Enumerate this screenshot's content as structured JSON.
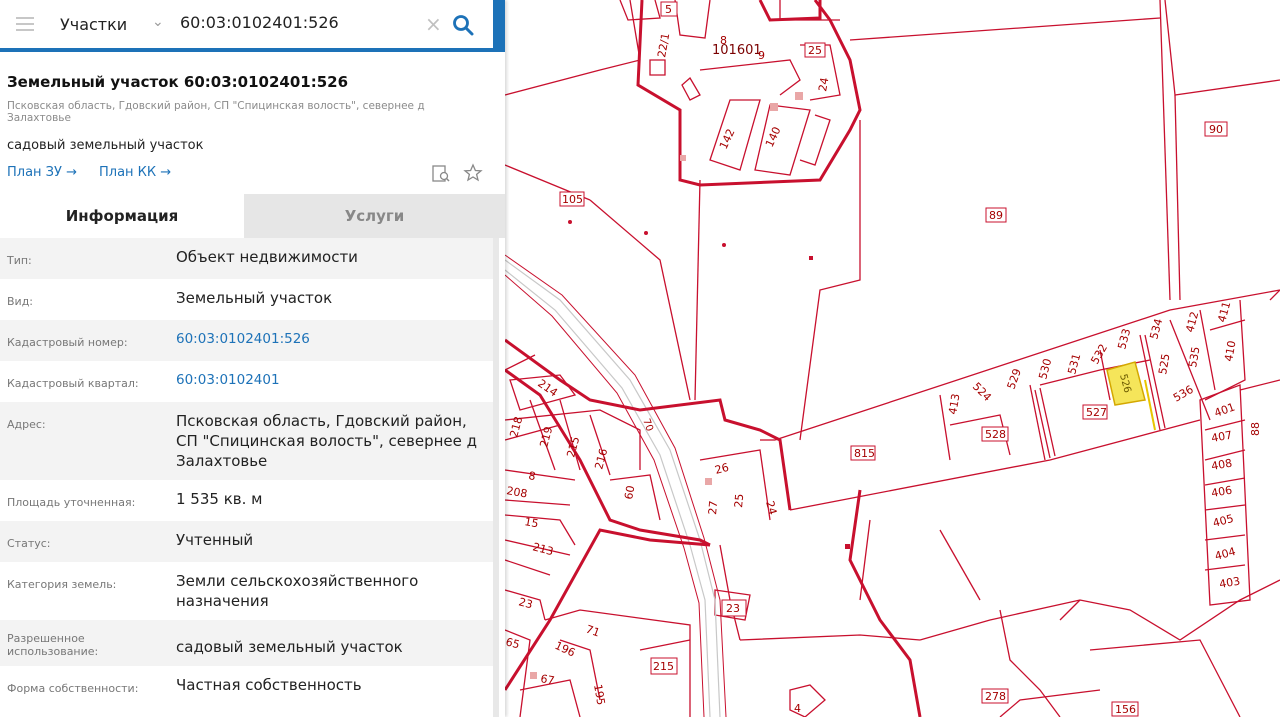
{
  "search": {
    "category": "Участки",
    "query": "60:03:0102401:526"
  },
  "card": {
    "title": "Земельный участок 60:03:0102401:526",
    "address_short": "Псковская область, Гдовский район, СП \"Спицинская волость\", севернее д Залахтовье",
    "purpose": "садовый земельный участок",
    "link_plan_zu": "План ЗУ →",
    "link_plan_kk": "План КК →"
  },
  "tabs": [
    "Информация",
    "Услуги"
  ],
  "info": [
    {
      "label": "Тип:",
      "value": "Объект недвижимости"
    },
    {
      "label": "Вид:",
      "value": "Земельный участок"
    },
    {
      "label": "Кадастровый номер:",
      "value": "60:03:0102401:526"
    },
    {
      "label": "Кадастровый квартал:",
      "value": "60:03:0102401"
    },
    {
      "label": "Адрес:",
      "value": "Псковская область, Гдовский район, СП \"Спицинская волость\", севернее д Залахтовье"
    },
    {
      "label": "Площадь уточненная:",
      "value": "1 535 кв. м"
    },
    {
      "label": "Статус:",
      "value": "Учтенный"
    },
    {
      "label": "Категория земель:",
      "value": "Земли сельскохозяйственного назначения"
    },
    {
      "label": "Разрешенное использование:",
      "value": "садовый земельный участок"
    },
    {
      "label": "Форма собственности:",
      "value": "Частная собственность"
    }
  ],
  "map_labels": {
    "l5": "5",
    "l22_1": "22/1",
    "l8": "8",
    "l101601": "101601",
    "l9": "9",
    "l25": "25",
    "l24": "24",
    "l142": "142",
    "l140": "140",
    "l90": "90",
    "l105": "105",
    "l89": "89",
    "l533": "533",
    "l534": "534",
    "l412": "412",
    "l411": "411",
    "l532": "532",
    "l531": "531",
    "l530": "530",
    "l529": "529",
    "l524": "524",
    "l413": "413",
    "l526": "526",
    "l525": "525",
    "l535": "535",
    "l410": "410",
    "l536": "536",
    "l527": "527",
    "l528": "528",
    "l401": "401",
    "l407": "407",
    "l88": "88",
    "l408": "408",
    "l406": "406",
    "l405": "405",
    "l404": "404",
    "l403": "403",
    "l815": "815",
    "l214": "214",
    "l218": "218",
    "l219": "219",
    "l215a": "215",
    "l216": "216",
    "l208": "208",
    "l8b": "8",
    "l26": "26",
    "l25b": "25",
    "l24b": "24",
    "l27": "27",
    "l60": "60",
    "l15": "15",
    "l213": "213",
    "l23": "23",
    "l23b": "23",
    "l71": "71",
    "l196": "196",
    "l195": "195",
    "l215b": "215",
    "l67": "67",
    "l65": "65",
    "l278": "278",
    "l156": "156",
    "l4": "4",
    "l70": "70"
  },
  "colors": {
    "accent": "#1d72b8",
    "parcel_line": "#c8102e",
    "selected_parcel": "#f5e55a"
  }
}
